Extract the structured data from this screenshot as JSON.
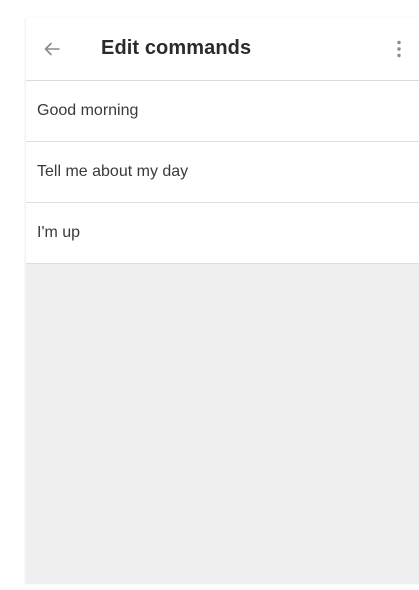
{
  "app_bar": {
    "title": "Edit commands",
    "back_icon": "arrow-left-icon",
    "more_icon": "more-vert-icon"
  },
  "commands": [
    {
      "label": "Good morning"
    },
    {
      "label": "Tell me about my day"
    },
    {
      "label": "I'm up"
    }
  ],
  "colors": {
    "app_bar_bg": "#ffffff",
    "page_bg": "#efefef",
    "title_text": "#2b2b2b",
    "item_text": "#3a3a3a",
    "icon": "#8a8a8a",
    "divider": "#dedede"
  }
}
